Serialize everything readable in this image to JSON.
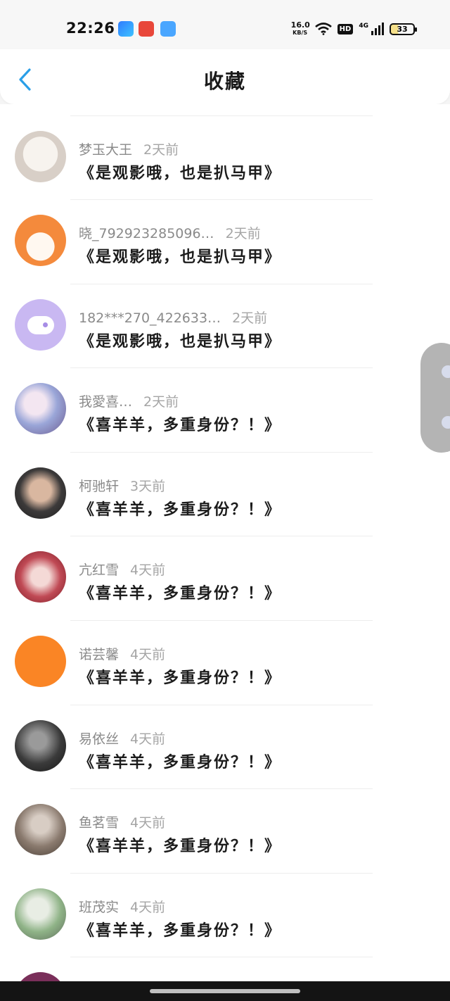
{
  "status_bar": {
    "time": "22:26",
    "net_speed_value": "16.0",
    "net_speed_unit": "KB/S",
    "hd_badge": "HD",
    "network_type": "4G",
    "battery_level": "33",
    "app_icons": [
      "blue-app-icon",
      "red-shopping-app-icon",
      "weather-app-icon"
    ]
  },
  "header": {
    "title": "收藏",
    "back_icon": "chevron-left-icon",
    "accent_color": "#2a9fe8"
  },
  "favorites": [
    {
      "name": "梦玉大王",
      "time": "2天前",
      "text": "《是观影哦，也是扒马甲》",
      "avatar_color": "#eeeae6"
    },
    {
      "name": "晓_792923285096…",
      "time": "2天前",
      "text": "《是观影哦，也是扒马甲》",
      "avatar_color": "#f48a3c"
    },
    {
      "name": "182***270_422633…",
      "time": "2天前",
      "text": "《是观影哦，也是扒马甲》",
      "avatar_color": "#c9b8f2"
    },
    {
      "name": "我愛喜…",
      "time": "2天前",
      "text": "《喜羊羊，多重身份？！》",
      "avatar_color": "#cfc6e2"
    },
    {
      "name": "柯驰轩",
      "time": "3天前",
      "text": "《喜羊羊，多重身份？！》",
      "avatar_color": "#3c3a3a"
    },
    {
      "name": "亢红雪",
      "time": "4天前",
      "text": "《喜羊羊，多重身份？！》",
      "avatar_color": "#c04a55"
    },
    {
      "name": "诺芸馨",
      "time": "4天前",
      "text": "《喜羊羊，多重身份？！》",
      "avatar_color": "#fa8525"
    },
    {
      "name": "易依丝",
      "time": "4天前",
      "text": "《喜羊羊，多重身份？！》",
      "avatar_color": "#3b3b3b"
    },
    {
      "name": "鱼茗雪",
      "time": "4天前",
      "text": "《喜羊羊，多重身份？！》",
      "avatar_color": "#8a7a6e"
    },
    {
      "name": "班茂实",
      "time": "4天前",
      "text": "《喜羊羊，多重身份？！》",
      "avatar_color": "#8fb387"
    },
    {
      "name": "",
      "time": "",
      "text": "",
      "avatar_color": "#7a2f5a"
    }
  ]
}
